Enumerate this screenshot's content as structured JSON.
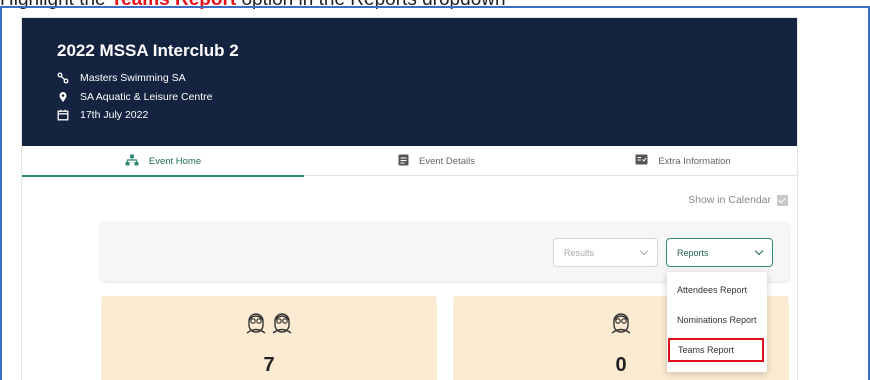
{
  "caption": {
    "visible_text": "Highlight the Teams Report option in the Reports dropdown",
    "visible_red": "Teams Report"
  },
  "event": {
    "title": "2022 MSSA Interclub 2",
    "organiser": "Masters Swimming SA",
    "venue": "SA Aquatic & Leisure Centre",
    "date": "17th July 2022"
  },
  "tabs": [
    {
      "label": "Event Home",
      "icon": "sitemap-icon",
      "active": true
    },
    {
      "label": "Event Details",
      "icon": "clipboard-icon",
      "active": false
    },
    {
      "label": "Extra Information",
      "icon": "info-card-icon",
      "active": false
    }
  ],
  "show_calendar": {
    "label": "Show in Calendar",
    "checked": true
  },
  "filters": {
    "results_placeholder": "Results",
    "reports_label": "Reports"
  },
  "reports_menu": [
    {
      "label": "Attendees Report",
      "highlighted": false
    },
    {
      "label": "Nominations Report",
      "highlighted": false
    },
    {
      "label": "Teams Report",
      "highlighted": true
    }
  ],
  "stats": [
    {
      "value": "7",
      "icon": "swimmers-pair-icon"
    },
    {
      "value": "0",
      "icon": "swimmer-icon"
    }
  ],
  "colors": {
    "header_bg": "#14233f",
    "accent_green": "#2f8a76",
    "card_bg": "#fcebd3",
    "highlight_red": "#e0101c"
  }
}
